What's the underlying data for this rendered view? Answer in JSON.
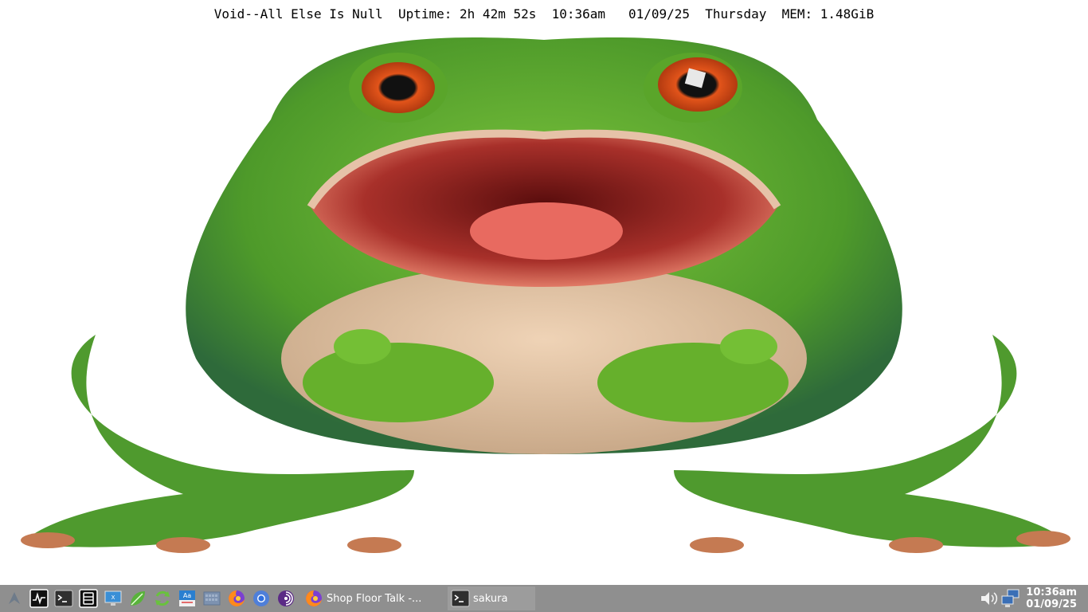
{
  "conky": {
    "text": "Void--All Else Is Null  Uptime: 2h 42m 52s  10:36am   01/09/25  Thursday  MEM: 1.48GiB"
  },
  "wallpaper": {
    "subject": "angry green frog with open mouth"
  },
  "taskbar": {
    "launchers": [
      {
        "name": "app-menu-icon"
      },
      {
        "name": "system-monitor-icon"
      },
      {
        "name": "terminal-icon"
      },
      {
        "name": "file-manager-icon"
      },
      {
        "name": "remote-desktop-icon"
      },
      {
        "name": "leaf-editor-icon"
      },
      {
        "name": "refresh-updater-icon"
      },
      {
        "name": "font-viewer-icon"
      },
      {
        "name": "keyboard-icon"
      },
      {
        "name": "firefox-icon"
      },
      {
        "name": "chromium-icon"
      },
      {
        "name": "tor-browser-icon"
      }
    ],
    "tasks": [
      {
        "label": "Shop Floor Talk -...",
        "icon": "firefox-icon"
      },
      {
        "label": "sakura",
        "icon": "terminal-icon"
      }
    ],
    "tray": {
      "volume_icon": "volume-icon",
      "network_icon": "network-icon"
    },
    "clock": {
      "time": "10:36am",
      "date": "01/09/25"
    }
  },
  "colors": {
    "taskbar_bg": "#8f8f8f",
    "frog_green": "#5aa52a",
    "frog_eye": "#e2541a"
  }
}
